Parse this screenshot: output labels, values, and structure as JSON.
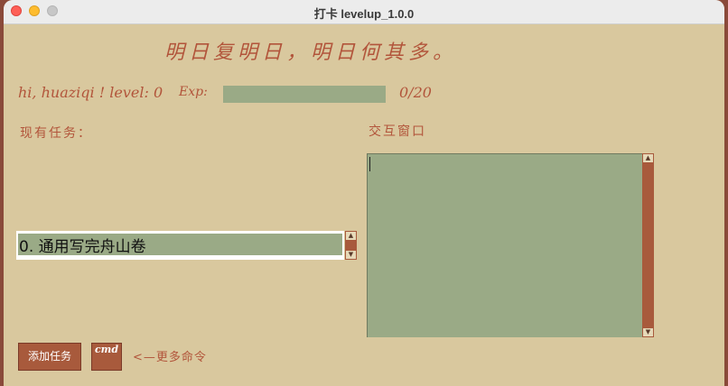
{
  "window": {
    "title": "打卡 levelup_1.0.0"
  },
  "header": {
    "motto": "明日复明日，明日何其多。"
  },
  "status": {
    "greeting": "hi, huaziqi ! level: 0",
    "exp_label": "Exp:",
    "exp_progress": 0.0,
    "exp_count": "0/20"
  },
  "tasks": {
    "label": "现有任务：",
    "items": [
      {
        "text": "0. 通用写完舟山卷"
      }
    ]
  },
  "interaction": {
    "label": "交互窗口",
    "content": ""
  },
  "buttons": {
    "add_task": "添加任务",
    "cmd": "cmd"
  },
  "hint": "<—更多命令",
  "colors": {
    "background": "#d9c89e",
    "accent": "#b2553b",
    "field": "#9aaa86",
    "button": "#a85a3c"
  }
}
